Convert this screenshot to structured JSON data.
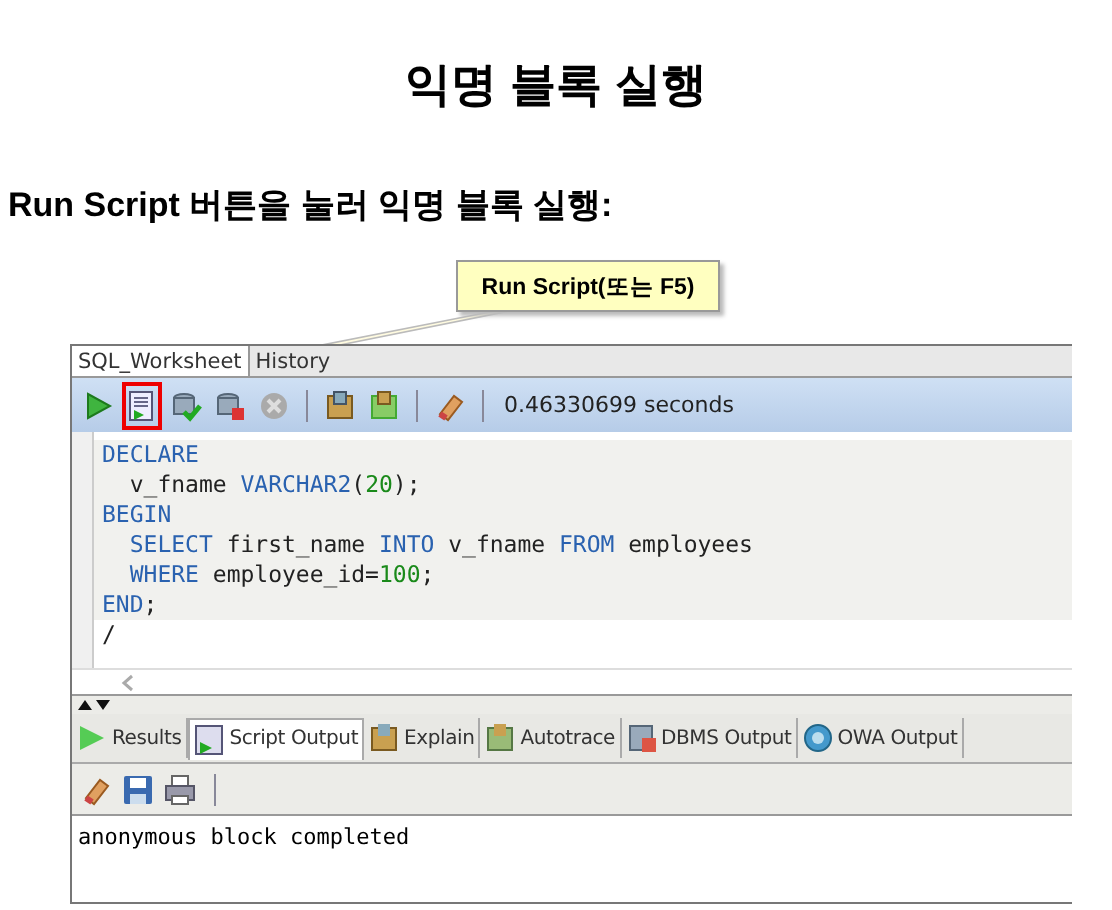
{
  "title": "익명 블록 실행",
  "subtitle": "Run Script 버튼을 눌러 익명 블록 실행:",
  "callout": {
    "text": "Run Script(또는 F5)"
  },
  "worksheet": {
    "tabs": [
      {
        "label": "SQL_Worksheet",
        "selected": true
      },
      {
        "label": "History",
        "selected": false
      }
    ],
    "toolbar": {
      "buttons": [
        {
          "highlighted": false
        },
        {
          "highlighted": true
        },
        {
          "highlighted": false
        },
        {
          "highlighted": false
        },
        {
          "highlighted": false
        },
        {
          "highlighted": false
        },
        {
          "highlighted": false
        },
        {
          "highlighted": false
        }
      ],
      "elapsed": "0.46330699 seconds"
    },
    "code": [
      {
        "indented": false,
        "tokens": [
          {
            "kind": "keyword",
            "text": "DECLARE"
          }
        ]
      },
      {
        "indented": true,
        "tokens": [
          {
            "kind": "plain",
            "text": "v_fname "
          },
          {
            "kind": "keyword",
            "text": "VARCHAR2"
          },
          {
            "kind": "plain",
            "text": "("
          },
          {
            "kind": "number",
            "text": "20"
          },
          {
            "kind": "plain",
            "text": ");"
          }
        ]
      },
      {
        "indented": false,
        "tokens": [
          {
            "kind": "keyword",
            "text": "BEGIN"
          }
        ]
      },
      {
        "indented": true,
        "tokens": [
          {
            "kind": "keyword",
            "text": "SELECT"
          },
          {
            "kind": "plain",
            "text": " first_name "
          },
          {
            "kind": "keyword",
            "text": "INTO"
          },
          {
            "kind": "plain",
            "text": " v_fname "
          },
          {
            "kind": "keyword",
            "text": "FROM"
          },
          {
            "kind": "plain",
            "text": " employees"
          }
        ]
      },
      {
        "indented": true,
        "tokens": [
          {
            "kind": "keyword",
            "text": "WHERE"
          },
          {
            "kind": "plain",
            "text": " employee_id="
          },
          {
            "kind": "number",
            "text": "100"
          },
          {
            "kind": "plain",
            "text": ";"
          }
        ]
      },
      {
        "indented": false,
        "tokens": [
          {
            "kind": "keyword",
            "text": "END"
          },
          {
            "kind": "plain",
            "text": ";"
          }
        ]
      },
      {
        "indented": false,
        "tokens": [
          {
            "kind": "plain",
            "text": "/"
          }
        ]
      }
    ],
    "output_tabs": [
      {
        "label": "Results",
        "selected": false
      },
      {
        "label": "Script Output",
        "selected": true
      },
      {
        "label": "Explain",
        "selected": false
      },
      {
        "label": "Autotrace",
        "selected": false
      },
      {
        "label": "DBMS Output",
        "selected": false
      },
      {
        "label": "OWA Output",
        "selected": false
      }
    ],
    "output": "anonymous block completed"
  }
}
